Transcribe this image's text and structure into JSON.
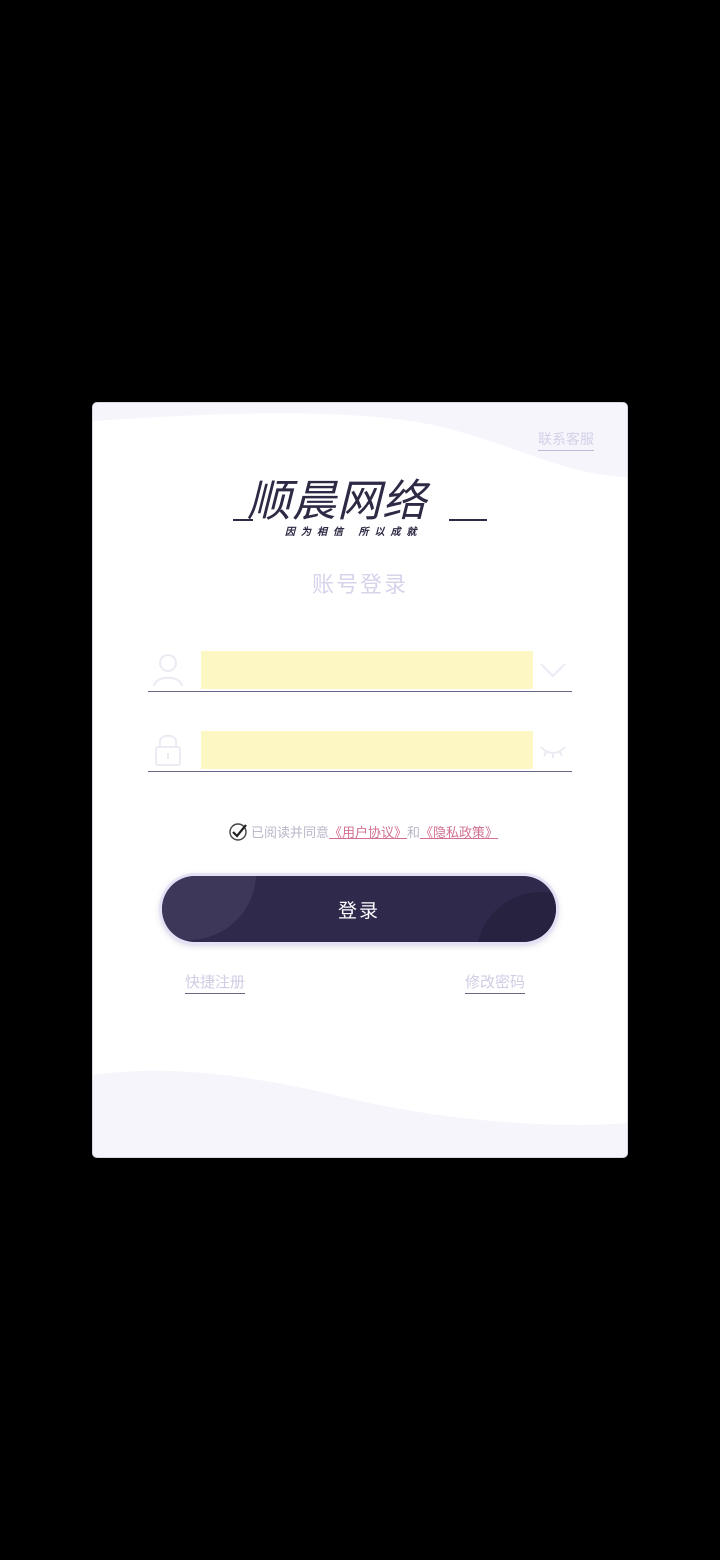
{
  "header": {
    "contact_label": "联系客服"
  },
  "logo": {
    "title": "顺晨网络",
    "slogan": "因为相信 所以成就"
  },
  "form": {
    "title": "账号登录",
    "username": {
      "value": "",
      "placeholder": ""
    },
    "password": {
      "value": "",
      "placeholder": ""
    }
  },
  "agreement": {
    "prefix": "已阅读并同意",
    "user_agreement": "《用户协议》",
    "and": "和",
    "privacy_policy": "《隐私政策》",
    "checked": true
  },
  "login_button": {
    "label": "登录"
  },
  "links": {
    "register": "快捷注册",
    "change_password": "修改密码"
  },
  "colors": {
    "primary": "#2f2a4c",
    "accent_link": "#d36f93",
    "input_autofill": "#fdf8c3"
  },
  "icons": [
    "user-icon",
    "chevron-down-icon",
    "lock-icon",
    "eye-closed-icon",
    "checkbox-checked-icon"
  ]
}
